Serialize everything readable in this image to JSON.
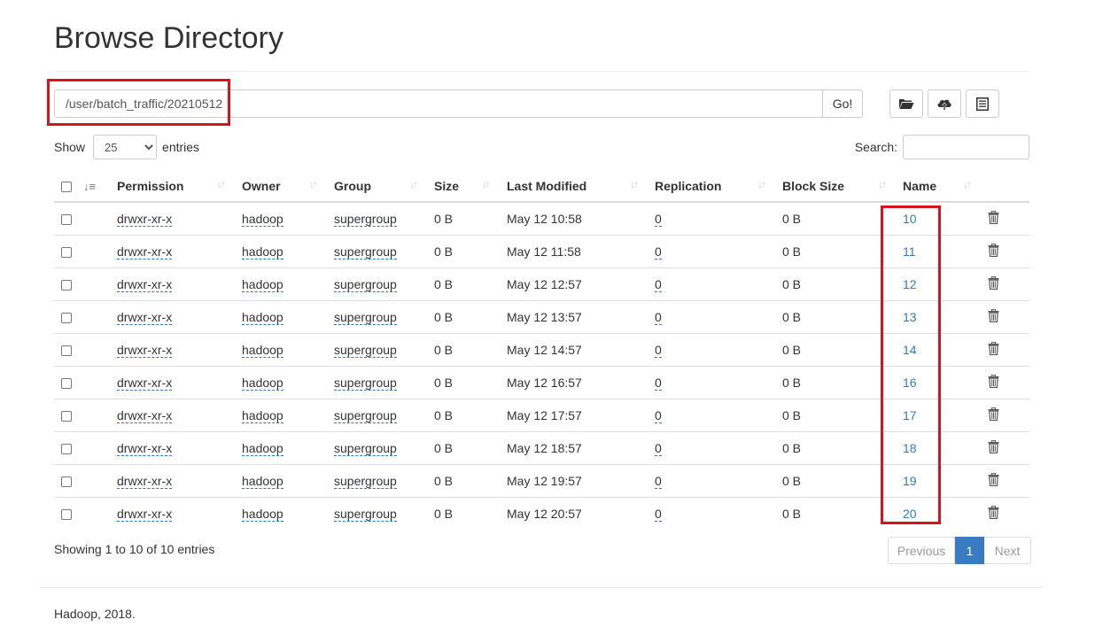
{
  "page": {
    "title": "Browse Directory"
  },
  "path_bar": {
    "value": "/user/batch_traffic/20210512",
    "go_label": "Go!"
  },
  "toolbar": {
    "icons": [
      "folder-open-icon",
      "cloud-upload-icon",
      "list-alt-icon"
    ]
  },
  "length_control": {
    "show_label": "Show",
    "entries_value": "25",
    "entries_label": "entries"
  },
  "search": {
    "label": "Search:",
    "value": ""
  },
  "table": {
    "headers": {
      "permission": "Permission",
      "owner": "Owner",
      "group": "Group",
      "size": "Size",
      "last_modified": "Last Modified",
      "replication": "Replication",
      "block_size": "Block Size",
      "name": "Name"
    },
    "rows": [
      {
        "permission": "drwxr-xr-x",
        "owner": "hadoop",
        "group": "supergroup",
        "size": "0 B",
        "last_modified": "May 12 10:58",
        "replication": "0",
        "block_size": "0 B",
        "name": "10"
      },
      {
        "permission": "drwxr-xr-x",
        "owner": "hadoop",
        "group": "supergroup",
        "size": "0 B",
        "last_modified": "May 12 11:58",
        "replication": "0",
        "block_size": "0 B",
        "name": "11"
      },
      {
        "permission": "drwxr-xr-x",
        "owner": "hadoop",
        "group": "supergroup",
        "size": "0 B",
        "last_modified": "May 12 12:57",
        "replication": "0",
        "block_size": "0 B",
        "name": "12"
      },
      {
        "permission": "drwxr-xr-x",
        "owner": "hadoop",
        "group": "supergroup",
        "size": "0 B",
        "last_modified": "May 12 13:57",
        "replication": "0",
        "block_size": "0 B",
        "name": "13"
      },
      {
        "permission": "drwxr-xr-x",
        "owner": "hadoop",
        "group": "supergroup",
        "size": "0 B",
        "last_modified": "May 12 14:57",
        "replication": "0",
        "block_size": "0 B",
        "name": "14"
      },
      {
        "permission": "drwxr-xr-x",
        "owner": "hadoop",
        "group": "supergroup",
        "size": "0 B",
        "last_modified": "May 12 16:57",
        "replication": "0",
        "block_size": "0 B",
        "name": "16"
      },
      {
        "permission": "drwxr-xr-x",
        "owner": "hadoop",
        "group": "supergroup",
        "size": "0 B",
        "last_modified": "May 12 17:57",
        "replication": "0",
        "block_size": "0 B",
        "name": "17"
      },
      {
        "permission": "drwxr-xr-x",
        "owner": "hadoop",
        "group": "supergroup",
        "size": "0 B",
        "last_modified": "May 12 18:57",
        "replication": "0",
        "block_size": "0 B",
        "name": "18"
      },
      {
        "permission": "drwxr-xr-x",
        "owner": "hadoop",
        "group": "supergroup",
        "size": "0 B",
        "last_modified": "May 12 19:57",
        "replication": "0",
        "block_size": "0 B",
        "name": "19"
      },
      {
        "permission": "drwxr-xr-x",
        "owner": "hadoop",
        "group": "supergroup",
        "size": "0 B",
        "last_modified": "May 12 20:57",
        "replication": "0",
        "block_size": "0 B",
        "name": "20"
      }
    ]
  },
  "info": {
    "text": "Showing 1 to 10 of 10 entries"
  },
  "pagination": {
    "previous": "Previous",
    "current": "1",
    "next": "Next"
  },
  "footer": {
    "text": "Hadoop, 2018."
  },
  "colors": {
    "highlight": "#d9131e",
    "link": "#337ab7",
    "active_page": "#3a7cc2"
  }
}
